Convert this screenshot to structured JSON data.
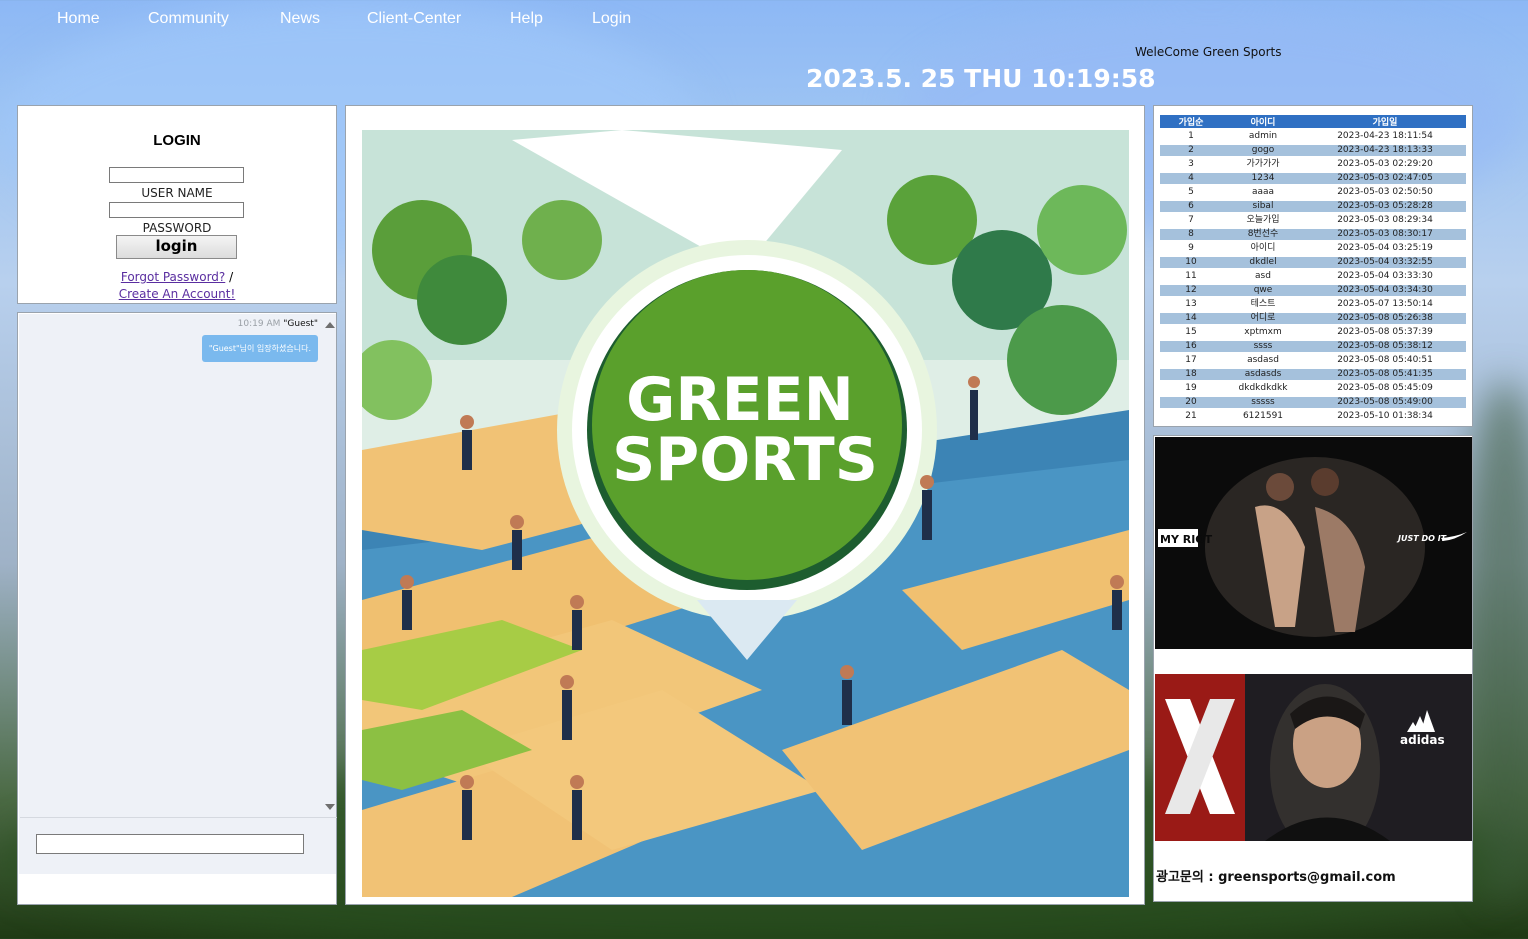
{
  "nav": {
    "items": [
      "Home",
      "Community",
      "News",
      "Client-Center",
      "Help",
      "Login"
    ]
  },
  "header": {
    "welcome": "WeleCome Green Sports",
    "clock": "2023.5. 25 THU 10:19:58"
  },
  "login": {
    "title": "LOGIN",
    "username_label": "USER NAME",
    "password_label": "PASSWORD",
    "username_value": "",
    "password_value": "",
    "button_label": "login",
    "forgot_link": "Forgot Password?",
    "separator": "/",
    "create_link": "Create An Account!"
  },
  "chat": {
    "time": "10:19 AM",
    "sender": "\"Guest\"",
    "message": "\"Guest\"님이 입장하셨습니다.",
    "input_value": ""
  },
  "hero": {
    "title_line1": "GREEN",
    "title_line2": "SPORTS"
  },
  "members": {
    "headers": [
      "가입순",
      "아이디",
      "가입일"
    ],
    "rows": [
      [
        "1",
        "admin",
        "2023-04-23 18:11:54"
      ],
      [
        "2",
        "gogo",
        "2023-04-23 18:13:33"
      ],
      [
        "3",
        "가가가가",
        "2023-05-03 02:29:20"
      ],
      [
        "4",
        "1234",
        "2023-05-03 02:47:05"
      ],
      [
        "5",
        "aaaa",
        "2023-05-03 02:50:50"
      ],
      [
        "6",
        "sibal",
        "2023-05-03 05:28:28"
      ],
      [
        "7",
        "오늘가입",
        "2023-05-03 08:29:34"
      ],
      [
        "8",
        "8번선수",
        "2023-05-03 08:30:17"
      ],
      [
        "9",
        "아이디",
        "2023-05-04 03:25:19"
      ],
      [
        "10",
        "dkdlel",
        "2023-05-04 03:32:55"
      ],
      [
        "11",
        "asd",
        "2023-05-04 03:33:30"
      ],
      [
        "12",
        "qwe",
        "2023-05-04 03:34:30"
      ],
      [
        "13",
        "테스트",
        "2023-05-07 13:50:14"
      ],
      [
        "14",
        "어디로",
        "2023-05-08 05:26:38"
      ],
      [
        "15",
        "xptmxm",
        "2023-05-08 05:37:39"
      ],
      [
        "16",
        "ssss",
        "2023-05-08 05:38:12"
      ],
      [
        "17",
        "asdasd",
        "2023-05-08 05:40:51"
      ],
      [
        "18",
        "asdasds",
        "2023-05-08 05:41:35"
      ],
      [
        "19",
        "dkdkdkdkk",
        "2023-05-08 05:45:09"
      ],
      [
        "20",
        "sssss",
        "2023-05-08 05:49:00"
      ],
      [
        "21",
        "6121591",
        "2023-05-10 01:38:34"
      ]
    ]
  },
  "ads": {
    "ad1_brand": "MY RIOT",
    "ad1_slogan": "JUST DO IT",
    "ad2_brand": "adidas",
    "contact": "광고문의 : greensports@gmail.com"
  },
  "colors": {
    "table_header": "#2f70c3",
    "table_alt_row": "#a5c1dc",
    "chat_bubble": "#7ab9ee",
    "logo_green": "#5aa02c"
  }
}
